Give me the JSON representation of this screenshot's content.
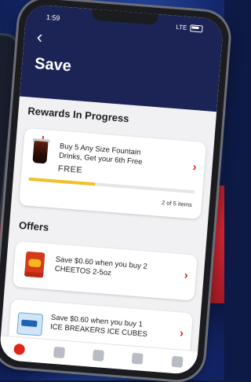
{
  "status_bar": {
    "time": "1:59",
    "network": "LTE"
  },
  "header": {
    "back_symbol": "‹",
    "title": "Save"
  },
  "rewards": {
    "section_title": "Rewards In Progress",
    "item": {
      "description": "Buy 5 Any Size Fountain Drinks, Get your 6th Free",
      "reward": "FREE",
      "progress_fraction": 0.4,
      "progress_text": "2 of 5 items"
    }
  },
  "offers": {
    "section_title": "Offers",
    "items": [
      {
        "text": "Save $0.60 when you buy 2 CHEETOS 2-5oz"
      },
      {
        "text": "Save $0.60 when you buy 1 ICE BREAKERS ICE CUBES"
      }
    ]
  },
  "colors": {
    "header_bg": "#1c2456",
    "accent": "#e1251b",
    "progress": "#f2c02a"
  },
  "tab_bar": {
    "icons": [
      "home-icon",
      "store-icon",
      "location-icon",
      "mail-icon",
      "more-icon"
    ]
  }
}
